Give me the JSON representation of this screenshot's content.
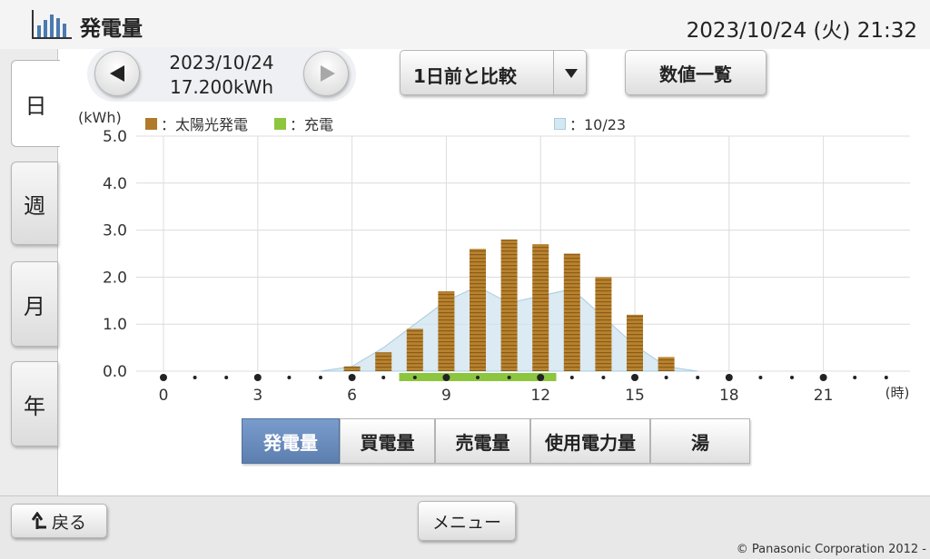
{
  "header": {
    "title": "発電量",
    "datetime": "2023/10/24 (火) 21:32"
  },
  "side_tabs": [
    {
      "label": "日",
      "active": true
    },
    {
      "label": "週",
      "active": false
    },
    {
      "label": "月",
      "active": false
    },
    {
      "label": "年",
      "active": false
    }
  ],
  "nav": {
    "date": "2023/10/24",
    "total": "17.200kWh"
  },
  "compare_dropdown": {
    "selected": "1日前と比較"
  },
  "list_button": "数値一覧",
  "legend": {
    "unit": "(kWh)",
    "solar": "：太陽光発電",
    "charge": "：充電",
    "compare": "：10/23"
  },
  "categories": [
    {
      "label": "発電量",
      "active": true
    },
    {
      "label": "買電量",
      "active": false
    },
    {
      "label": "売電量",
      "active": false
    },
    {
      "label": "使用電力量",
      "active": false
    },
    {
      "label": "湯",
      "active": false
    }
  ],
  "footer": {
    "back": "戻る",
    "menu": "メニュー",
    "copyright": "© Panasonic Corporation 2012 -"
  },
  "colors": {
    "solar": "#b07a2a",
    "charge": "#8cc63f",
    "compare_fill": "#cfe3ef",
    "compare_line": "#a9cce0",
    "active_tab": "#5c7fb0"
  },
  "chart_data": {
    "type": "bar",
    "x_unit": "(時)",
    "ylabel": "(kWh)",
    "ylim": [
      0,
      5
    ],
    "y_ticks": [
      "0.0",
      "1.0",
      "2.0",
      "3.0",
      "4.0",
      "5.0"
    ],
    "x_ticks": [
      "0",
      "3",
      "6",
      "9",
      "12",
      "15",
      "18",
      "21"
    ],
    "hours": [
      0,
      1,
      2,
      3,
      4,
      5,
      6,
      7,
      8,
      9,
      10,
      11,
      12,
      13,
      14,
      15,
      16,
      17,
      18,
      19,
      20,
      21,
      22,
      23
    ],
    "series": [
      {
        "name": "太陽光発電",
        "values": [
          0,
          0,
          0,
          0,
          0,
          0,
          0.1,
          0.4,
          0.9,
          1.7,
          2.6,
          2.8,
          2.7,
          2.5,
          2.0,
          1.2,
          0.3,
          0,
          0,
          0,
          0,
          0,
          0,
          0
        ]
      },
      {
        "name": "10/23",
        "values": [
          0,
          0,
          0,
          0,
          0,
          0,
          0.1,
          0.5,
          1.0,
          1.5,
          1.8,
          1.45,
          1.6,
          1.75,
          1.15,
          0.55,
          0.1,
          0,
          0,
          0,
          0,
          0,
          0,
          0
        ]
      }
    ],
    "charge_range": [
      7.5,
      12.5
    ]
  }
}
